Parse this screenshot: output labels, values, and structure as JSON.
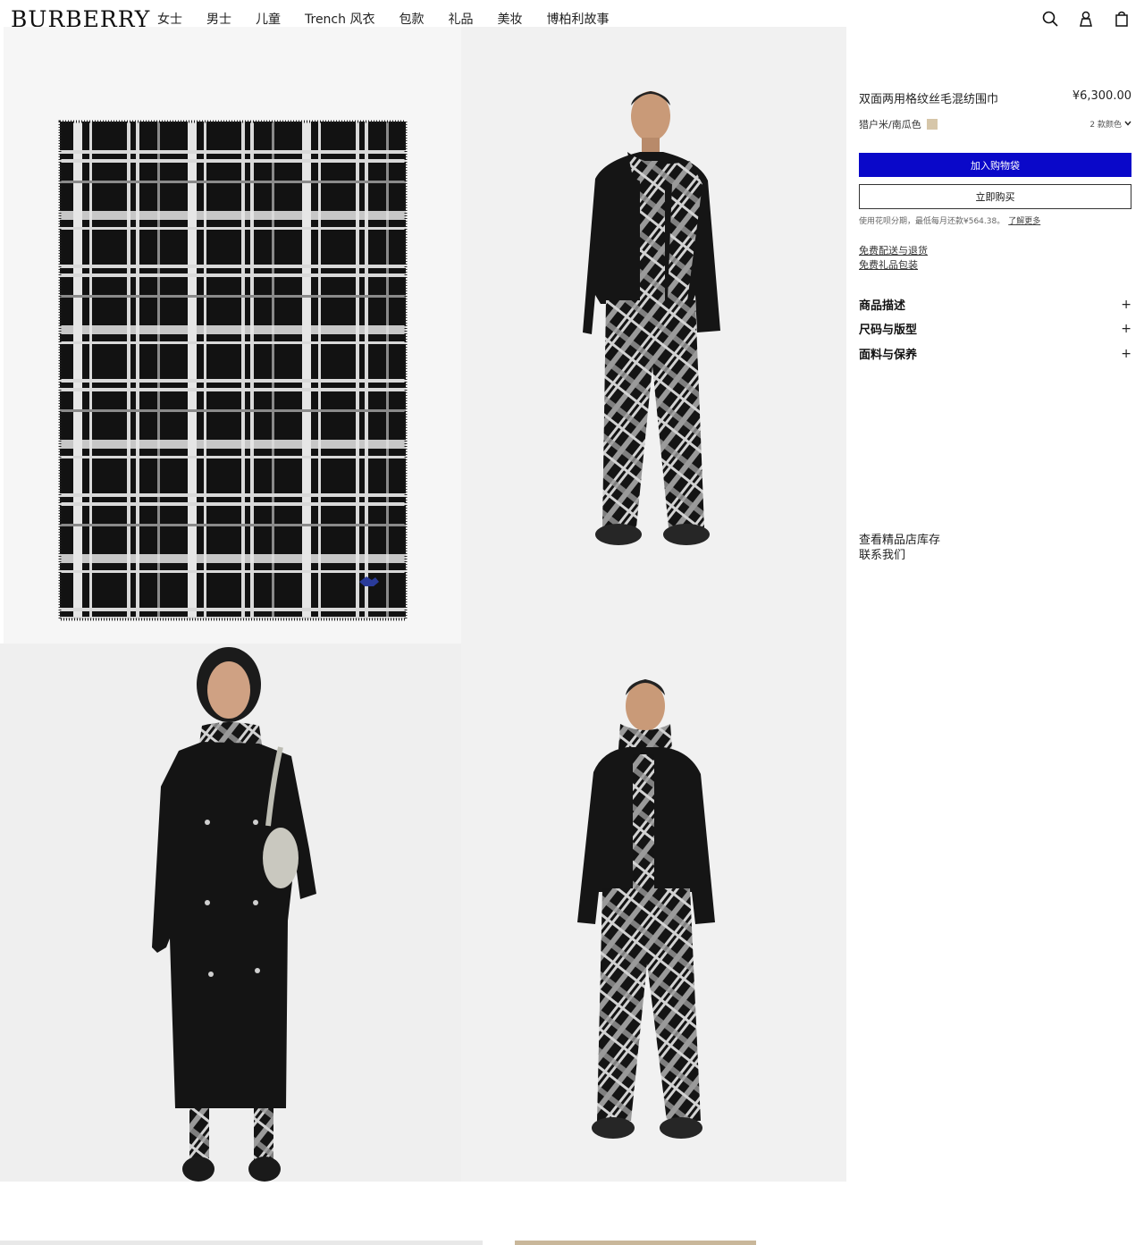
{
  "header": {
    "logo": "BURBERRY",
    "nav": [
      "女士",
      "男士",
      "儿童",
      "Trench 风衣",
      "包款",
      "礼品",
      "美妆",
      "博柏利故事"
    ],
    "icons": [
      "search-icon",
      "account-icon",
      "bag-icon"
    ]
  },
  "product": {
    "name": "双面两用格纹丝毛混纺围巾",
    "price": "¥6,300.00",
    "color_name": "猎户米/南瓜色",
    "swatch_color": "#d6c6a9",
    "color_count": "2 款颜色",
    "add_to_cart": "加入购物袋",
    "buy_now": "立即购买",
    "installment_text": "使用花呗分期，最低每月还款¥564.38。",
    "learn_more": "了解更多",
    "links": [
      "免费配送与退货",
      "免费礼品包装"
    ],
    "accordion": [
      "商品描述",
      "尺码与版型",
      "面料与保养"
    ],
    "store_links": [
      "查看精品店库存",
      "联系我们"
    ]
  },
  "colors": {
    "accent": "#0a08c9",
    "check_dark": "#111111",
    "check_light": "#d9d9d9",
    "ekd_blue": "#2a3b9a"
  }
}
